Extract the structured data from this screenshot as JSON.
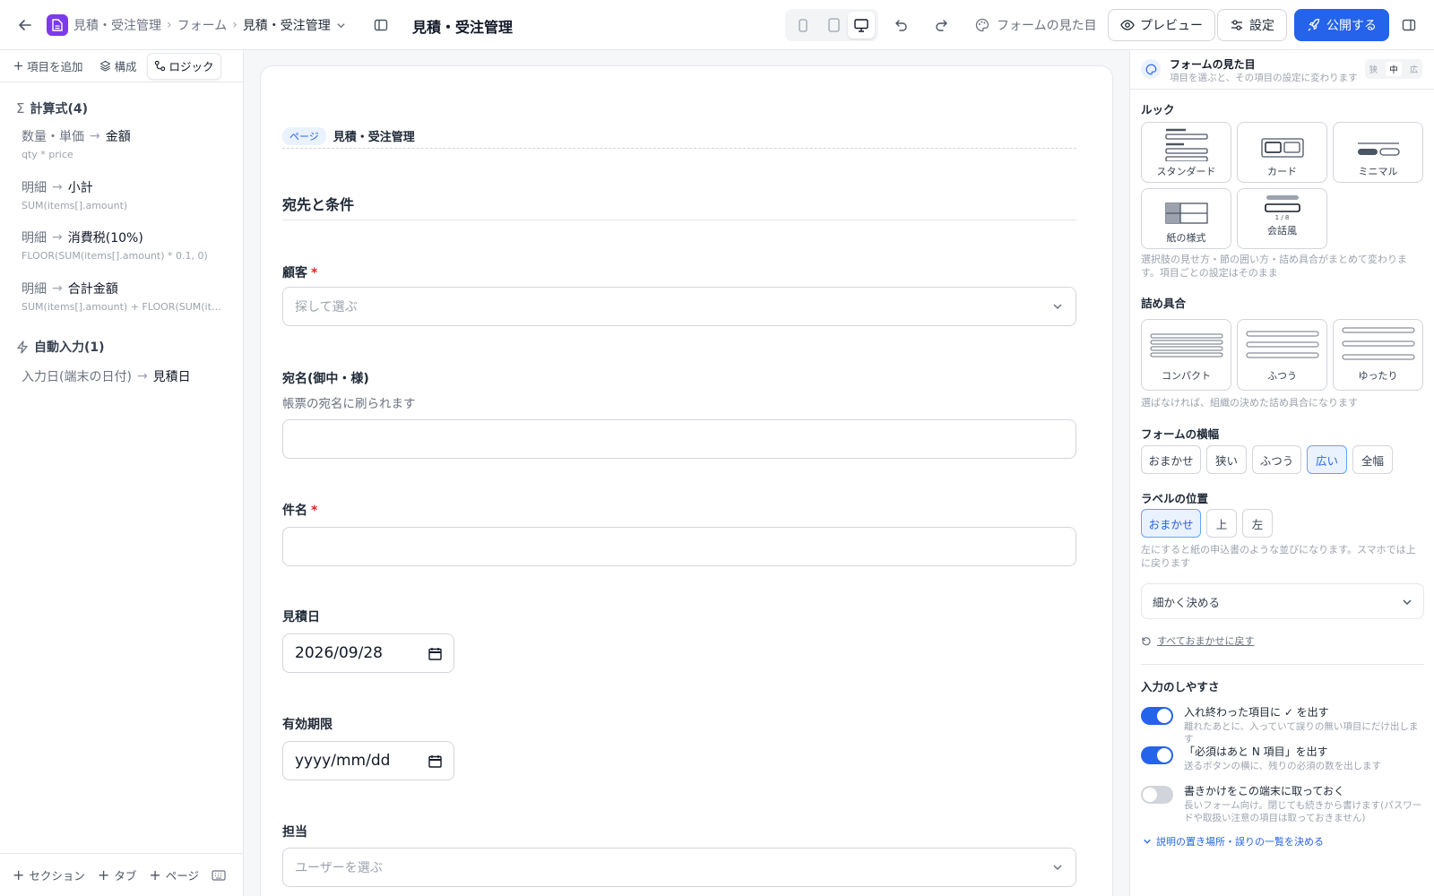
{
  "header": {
    "breadcrumb_app": "見積・受注管理",
    "breadcrumb_section": "フォーム",
    "breadcrumb_current": "見積・受注管理",
    "title": "見積・受注管理",
    "appearance_label": "フォームの見た目",
    "preview_label": "プレビュー",
    "settings_label": "設定",
    "publish_label": "公開する",
    "accent_color": "#2563eb",
    "app_icon_color": "#7c3aed"
  },
  "left": {
    "tabs": {
      "add": "項目を追加",
      "structure": "構成",
      "logic": "ロジック"
    },
    "formulas_title": "計算式(4)",
    "formulas": [
      {
        "src": "数量・単価",
        "target": "金額",
        "expr": "qty * price"
      },
      {
        "src": "明細",
        "target": "小計",
        "expr": "SUM(items[].amount)"
      },
      {
        "src": "明細",
        "target": "消費税(10%)",
        "expr": "FLOOR(SUM(items[].amount) * 0.1, 0)"
      },
      {
        "src": "明細",
        "target": "合計金額",
        "expr": "SUM(items[].amount) + FLOOR(SUM(it…"
      }
    ],
    "autofill_title": "自動入力(1)",
    "autofill": [
      {
        "src": "入力日(端末の日付)",
        "target": "見積日"
      }
    ],
    "footer": {
      "section": "セクション",
      "tab": "タブ",
      "page": "ページ"
    }
  },
  "form": {
    "page_badge": "ページ",
    "page_title": "見積・受注管理",
    "section_title": "宛先と条件",
    "customer_label": "顧客",
    "customer_placeholder": "探して選ぶ",
    "addressee_label": "宛名(御中・様)",
    "addressee_help": "帳票の宛名に刷られます",
    "subject_label": "件名",
    "date_label": "見積日",
    "date_value": "2026/09/28",
    "expiry_label": "有効期限",
    "expiry_placeholder": "yyyy/mm/dd",
    "owner_label": "担当",
    "owner_placeholder": "ユーザーを選ぶ",
    "required_mark": "*"
  },
  "panel": {
    "title": "フォームの見た目",
    "subtitle": "項目を選ぶと、その項目の設定に変わります",
    "size_options": [
      "狭",
      "中",
      "広"
    ],
    "look_title": "ルック",
    "looks": [
      "スタンダード",
      "カード",
      "ミニマル",
      "紙の様式",
      "会話風"
    ],
    "look_paper_counter": "1 / 8",
    "look_note": "選択肢の見せ方・節の囲い方・詰め具合がまとめて変わります。項目ごとの設定はそのまま",
    "density_title": "詰め具合",
    "densities": [
      "コンパクト",
      "ふつう",
      "ゆったり"
    ],
    "density_note": "選ばなければ、組織の決めた詰め具合になります",
    "width_title": "フォームの横幅",
    "widths": [
      "おまかせ",
      "狭い",
      "ふつう",
      "広い",
      "全幅"
    ],
    "width_selected": "広い",
    "label_pos_title": "ラベルの位置",
    "label_positions": [
      "おまかせ",
      "上",
      "左"
    ],
    "label_pos_selected": "おまかせ",
    "label_pos_note": "左にすると紙の申込書のような並びになります。スマホでは上に戻ります",
    "detail_select": "細かく決める",
    "reset_link": "すべておまかせに戻す",
    "usability_title": "入力のしやすさ",
    "toggles": [
      {
        "title": "入れ終わった項目に ✓ を出す",
        "sub": "離れたあとに、入っていて誤りの無い項目にだけ出します",
        "on": true
      },
      {
        "title": "「必須はあと N 項目」を出す",
        "sub": "送るボタンの横に、残りの必須の数を出します",
        "on": true
      },
      {
        "title": "書きかけをこの端末に取っておく",
        "sub": "長いフォーム向け。閉じても続きから書けます(パスワードや取扱い注意の項目は取っておきません)",
        "on": false
      }
    ],
    "more_link": "説明の置き場所・誤りの一覧を決める"
  }
}
